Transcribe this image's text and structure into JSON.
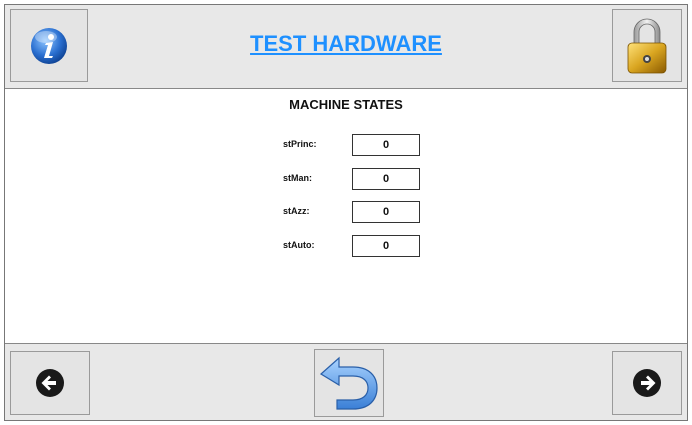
{
  "header": {
    "title": "TEST HARDWARE",
    "info_icon": "info-icon",
    "lock_icon": "padlock-icon"
  },
  "main": {
    "section_title": "MACHINE STATES",
    "states": [
      {
        "label": "stPrinc:",
        "value": "0"
      },
      {
        "label": "stMan:",
        "value": "0"
      },
      {
        "label": "stAzz:",
        "value": "0"
      },
      {
        "label": "stAuto:",
        "value": "0"
      }
    ]
  },
  "footer": {
    "back_icon": "arrow-left-icon",
    "return_icon": "undo-arrow-icon",
    "next_icon": "arrow-right-icon"
  },
  "colors": {
    "title": "#1e90ff",
    "bar_bg": "#e8e8e8",
    "info_blue": "#2a6fd0",
    "return_blue": "#4a8fe0",
    "lock_gold": "#d9a520"
  }
}
